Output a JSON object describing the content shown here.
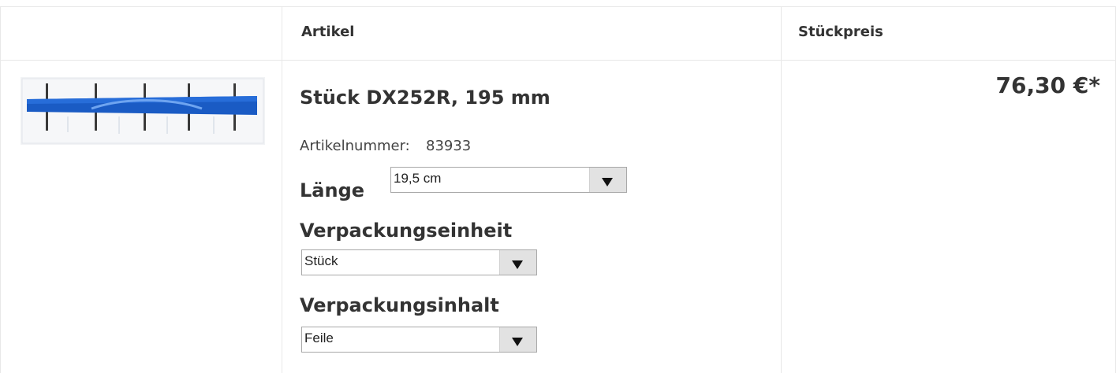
{
  "header": {
    "col_article": "Artikel",
    "col_price": "Stückpreis"
  },
  "product": {
    "title": "Stück DX252R, 195 mm",
    "article_number_label": "Artikelnummer:",
    "article_number": "83933",
    "options": [
      {
        "label": "Länge",
        "selected": "19,5 cm"
      },
      {
        "label": "Verpackungseinheit",
        "selected": "Stück"
      },
      {
        "label": "Verpackungsinhalt",
        "selected": "Feile"
      }
    ],
    "price": "76,30 €*",
    "image_icon": "file-package-image"
  },
  "colors": {
    "border": "#e8e8e8",
    "file_blue": "#1a5bc4",
    "select_arrow_bg": "#e2e2e2"
  }
}
